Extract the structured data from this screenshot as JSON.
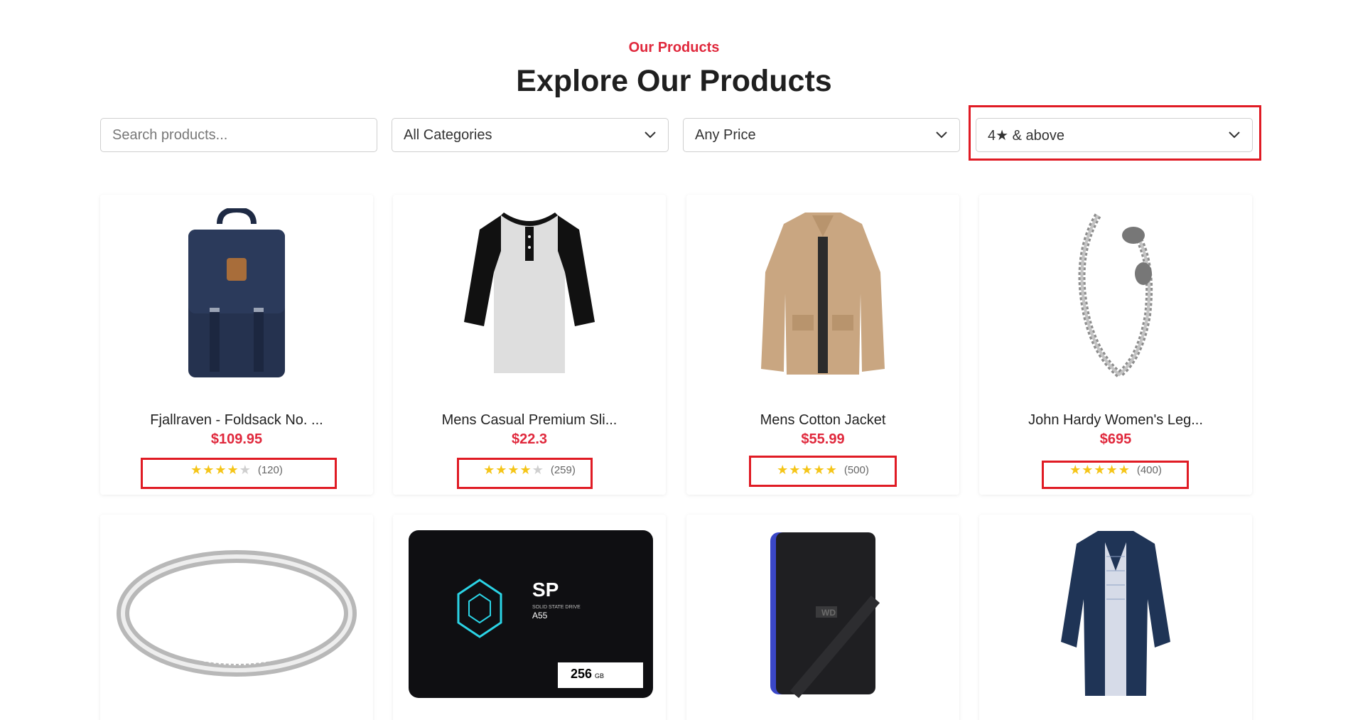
{
  "header": {
    "eyebrow": "Our Products",
    "title": "Explore Our Products"
  },
  "filters": {
    "search_placeholder": "Search products...",
    "category": "All Categories",
    "price": "Any Price",
    "rating": "4★ & above"
  },
  "products": [
    {
      "name": "Fjallraven - Foldsack No. ...",
      "price": "$109.95",
      "rating": 4,
      "count": "(120)",
      "image": "navy-backpack"
    },
    {
      "name": "Mens Casual Premium Sli...",
      "price": "$22.3",
      "rating": 4,
      "count": "(259)",
      "image": "raglan-henley-shirt"
    },
    {
      "name": "Mens Cotton Jacket",
      "price": "$55.99",
      "rating": 5,
      "count": "(500)",
      "image": "khaki-cotton-jacket"
    },
    {
      "name": "John Hardy Women's Leg...",
      "price": "$695",
      "rating": 5,
      "count": "(400)",
      "image": "dragon-chain-bracelet"
    },
    {
      "image": "silver-diamond-ring"
    },
    {
      "image": "ssd-drive",
      "brand": "SP",
      "subtitle": "SOLID STATE DRIVE",
      "model": "A55",
      "capacity": "256",
      "unit": "GB"
    },
    {
      "image": "portable-hard-drive",
      "brand": "WD"
    },
    {
      "image": "navy-rain-jacket"
    }
  ],
  "colors": {
    "accent": "#e0283c",
    "highlight": "#e01b24",
    "star": "#f5c518",
    "star_empty": "#cfcfcf"
  }
}
